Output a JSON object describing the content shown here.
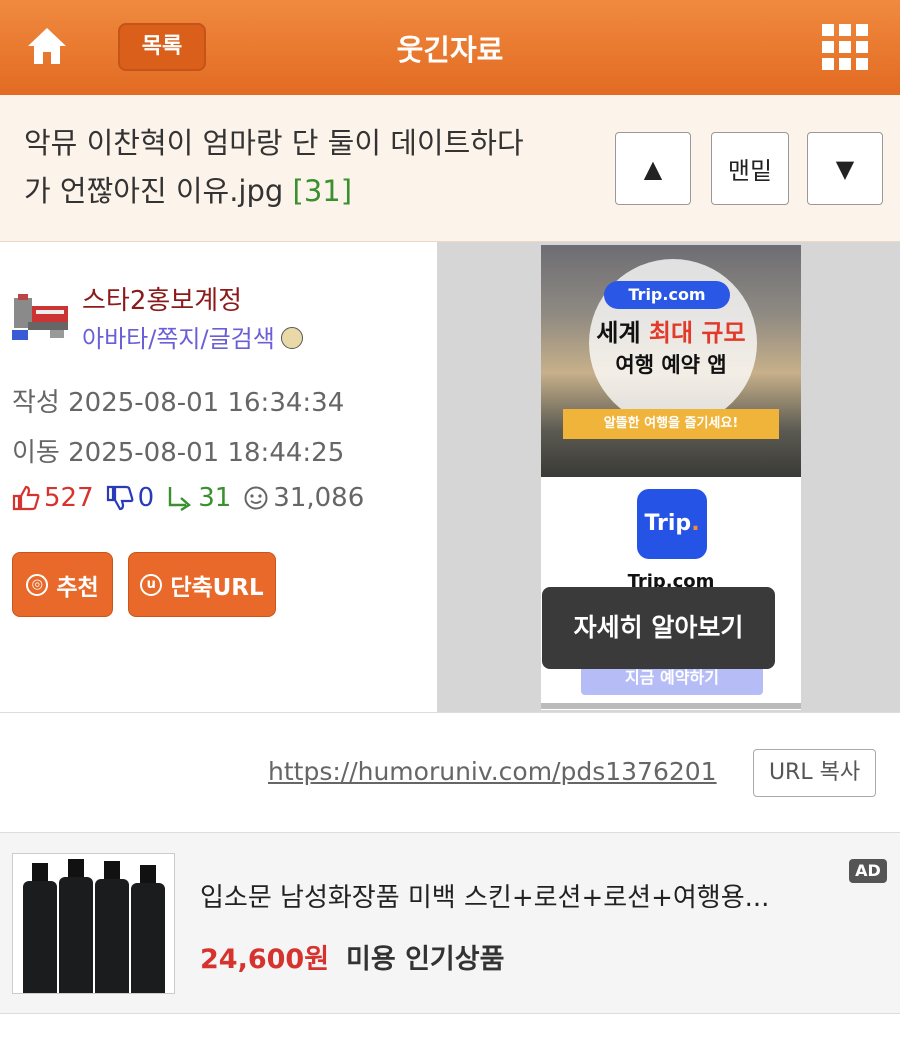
{
  "header": {
    "list_label": "목록",
    "title": "웃긴자료"
  },
  "post": {
    "title_line1": "악뮤 이찬혁이 엄마랑 단 둘이 데이트하다",
    "title_line2": "가 언짢아진 이유.jpg",
    "comment_count": "[31]"
  },
  "nav": {
    "up_symbol": "▲",
    "bottom_label": "맨밑",
    "down_symbol": "▼"
  },
  "author": {
    "name": "스타2홍보계정",
    "links": "아바타/쪽지/글검색"
  },
  "dates": {
    "written": "작성 2025-08-01 16:34:34",
    "moved": "이동 2025-08-01 18:44:25"
  },
  "stats": {
    "recommend": "527",
    "oppose": "0",
    "replies": "31",
    "views": "31,086"
  },
  "actions": {
    "recommend_label": "추천",
    "short_url_label": "단축URL"
  },
  "side_ad": {
    "brand_pill": "Trip.com",
    "headline_part1": "세계 ",
    "headline_highlight": "최대 규모",
    "headline2": "여행 예약 앱",
    "ribbon": "알뜰한 여행을 즐기세요!",
    "logo_text": "Trip",
    "logo_dot": ".",
    "app_name": "Trip.com",
    "cta": "지금 예약하기",
    "tooltip": "자세히 알아보기"
  },
  "url": {
    "link": "https://humoruniv.com/pds1376201",
    "copy_label": "URL 복사"
  },
  "product": {
    "name": "입소문 남성화장품 미백 스킨+로션+로션+여행용...",
    "price": "24,600원",
    "tag": "미용 인기상품",
    "ad_mark": "AD"
  },
  "colors": {
    "header_orange": "#e26b22",
    "title_bg": "#fcf3ea",
    "up_red": "#d6332e",
    "down_blue": "#2a3bb7",
    "reply_green": "#3a8f2f",
    "trip_blue": "#2453e6"
  },
  "icons": [
    "home-icon",
    "grid-menu-icon",
    "thumbs-up-icon",
    "thumbs-down-icon",
    "reply-arrow-icon",
    "view-face-icon",
    "badge-icon"
  ]
}
